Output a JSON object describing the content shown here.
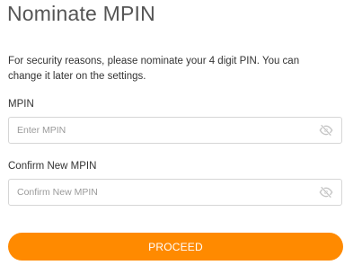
{
  "page": {
    "title": "Nominate MPIN",
    "intro_line1": "For security reasons, please nominate your 4 digit PIN. You can",
    "intro_line2": "change it later on the settings."
  },
  "form": {
    "mpin": {
      "label": "MPIN",
      "placeholder": "Enter MPIN",
      "value": "",
      "toggle_icon": "eye-slash-icon"
    },
    "confirm_mpin": {
      "label": "Confirm New MPIN",
      "placeholder": "Confirm New MPIN",
      "value": "",
      "toggle_icon": "eye-slash-icon"
    }
  },
  "actions": {
    "proceed_label": "PROCEED"
  },
  "colors": {
    "accent": "#ff8a00",
    "title_text": "#555555",
    "border": "#d6d6d6",
    "icon": "#c4c4c4"
  }
}
